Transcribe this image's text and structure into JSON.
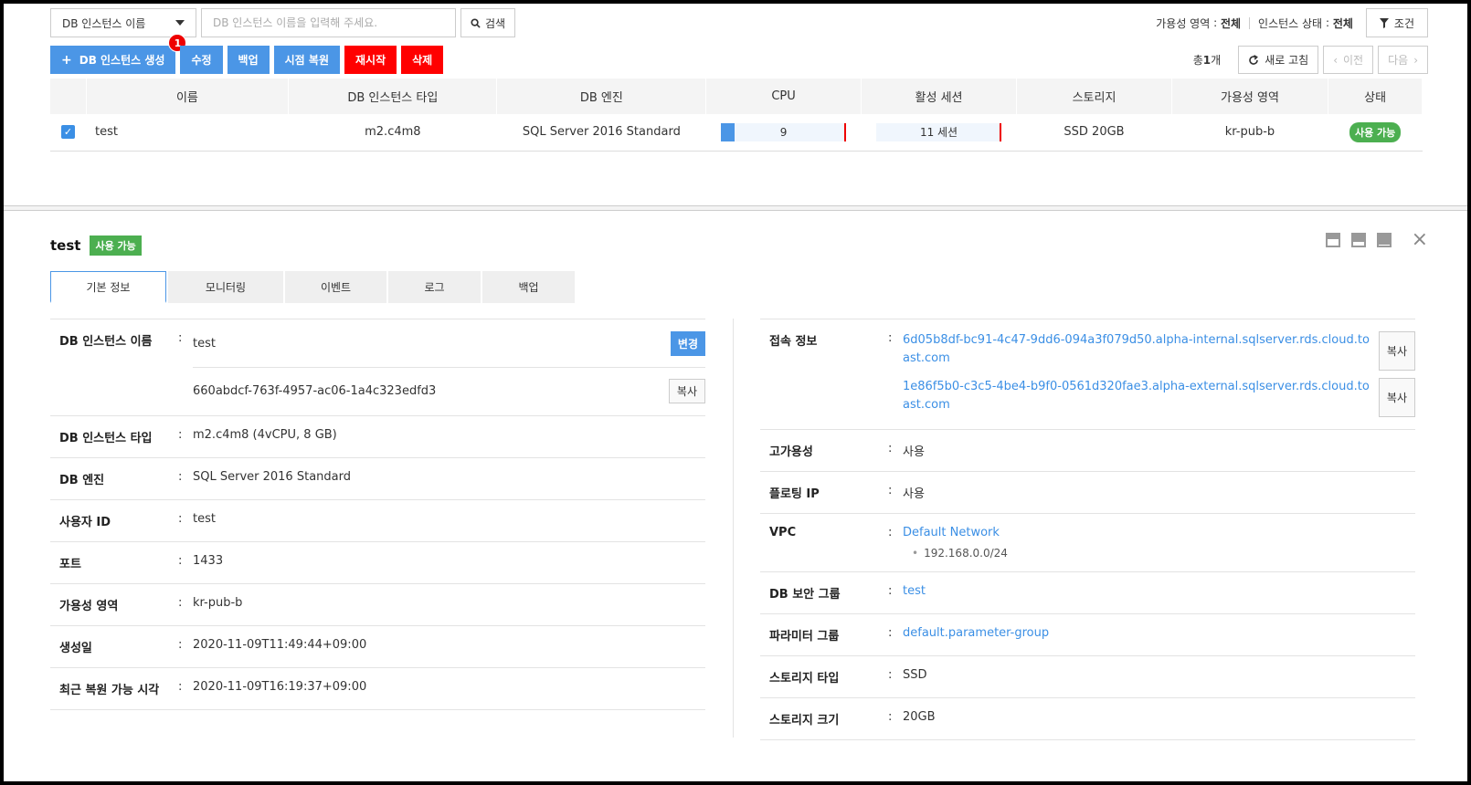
{
  "toolbar": {
    "select_label": "DB 인스턴스 이름",
    "search_placeholder": "DB 인스턴스 이름을 입력해 주세요.",
    "search_button": "검색",
    "zone_label": "가용성 영역",
    "zone_value": "전체",
    "status_label": "인스턴스 상태",
    "status_value": "전체",
    "condition_button": "조건",
    "colon": ":"
  },
  "actions": {
    "create": "DB 인스턴스 생성",
    "edit": "수정",
    "backup": "백업",
    "pitr": "시점 복원",
    "restart": "재시작",
    "delete": "삭제",
    "badge": "1",
    "total_prefix": "총",
    "total_count": "1",
    "total_suffix": "개",
    "refresh": "새로 고침",
    "prev": "이전",
    "next": "다음"
  },
  "table": {
    "headers": [
      "이름",
      "DB 인스턴스 타입",
      "DB 엔진",
      "CPU",
      "활성 세션",
      "스토리지",
      "가용성 영역",
      "상태"
    ],
    "rows": [
      {
        "name": "test",
        "type": "m2.c4m8",
        "engine": "SQL Server 2016 Standard",
        "cpu": "9",
        "cpu_pct": 0.11,
        "sessions": "11 세션",
        "sessions_pct": 0.0,
        "storage": "SSD 20GB",
        "zone": "kr-pub-b",
        "status": "사용 가능"
      }
    ]
  },
  "detail": {
    "name": "test",
    "status": "사용 가능",
    "tabs": [
      "기본 정보",
      "모니터링",
      "이벤트",
      "로그",
      "백업"
    ],
    "left": {
      "instance_name_label": "DB 인스턴스 이름",
      "instance_name": "test",
      "change_button": "변경",
      "instance_id": "660abdcf-763f-4957-ac06-1a4c323edfd3",
      "copy_button": "복사",
      "type_label": "DB 인스턴스 타입",
      "type_value": "m2.c4m8 (4vCPU, 8 GB)",
      "engine_label": "DB 엔진",
      "engine_value": "SQL Server 2016 Standard",
      "user_label": "사용자 ID",
      "user_value": "test",
      "port_label": "포트",
      "port_value": "1433",
      "zone_label": "가용성 영역",
      "zone_value": "kr-pub-b",
      "created_label": "생성일",
      "created_value": "2020-11-09T11:49:44+09:00",
      "restore_label": "최근 복원 가능 시각",
      "restore_value": "2020-11-09T16:19:37+09:00"
    },
    "right": {
      "conn_label": "접속 정보",
      "conn_internal": "6d05b8df-bc91-4c47-9dd6-094a3f079d50.alpha-internal.sqlserver.rds.cloud.toast.com",
      "conn_external": "1e86f5b0-c3c5-4be4-b9f0-0561d320fae3.alpha-external.sqlserver.rds.cloud.toast.com",
      "copy_button": "복사",
      "ha_label": "고가용성",
      "ha_value": "사용",
      "fip_label": "플로팅 IP",
      "fip_value": "사용",
      "vpc_label": "VPC",
      "vpc_value": "Default Network",
      "vpc_cidr": "192.168.0.0/24",
      "sg_label": "DB 보안 그룹",
      "sg_value": "test",
      "pg_label": "파라미터 그룹",
      "pg_value": "default.parameter-group",
      "st_type_label": "스토리지 타입",
      "st_type_value": "SSD",
      "st_size_label": "스토리지 크기",
      "st_size_value": "20GB"
    }
  },
  "colors": {
    "primary": "#4b96e6",
    "danger": "#ff0000",
    "success": "#4caf50",
    "link": "#3b8fe5"
  }
}
